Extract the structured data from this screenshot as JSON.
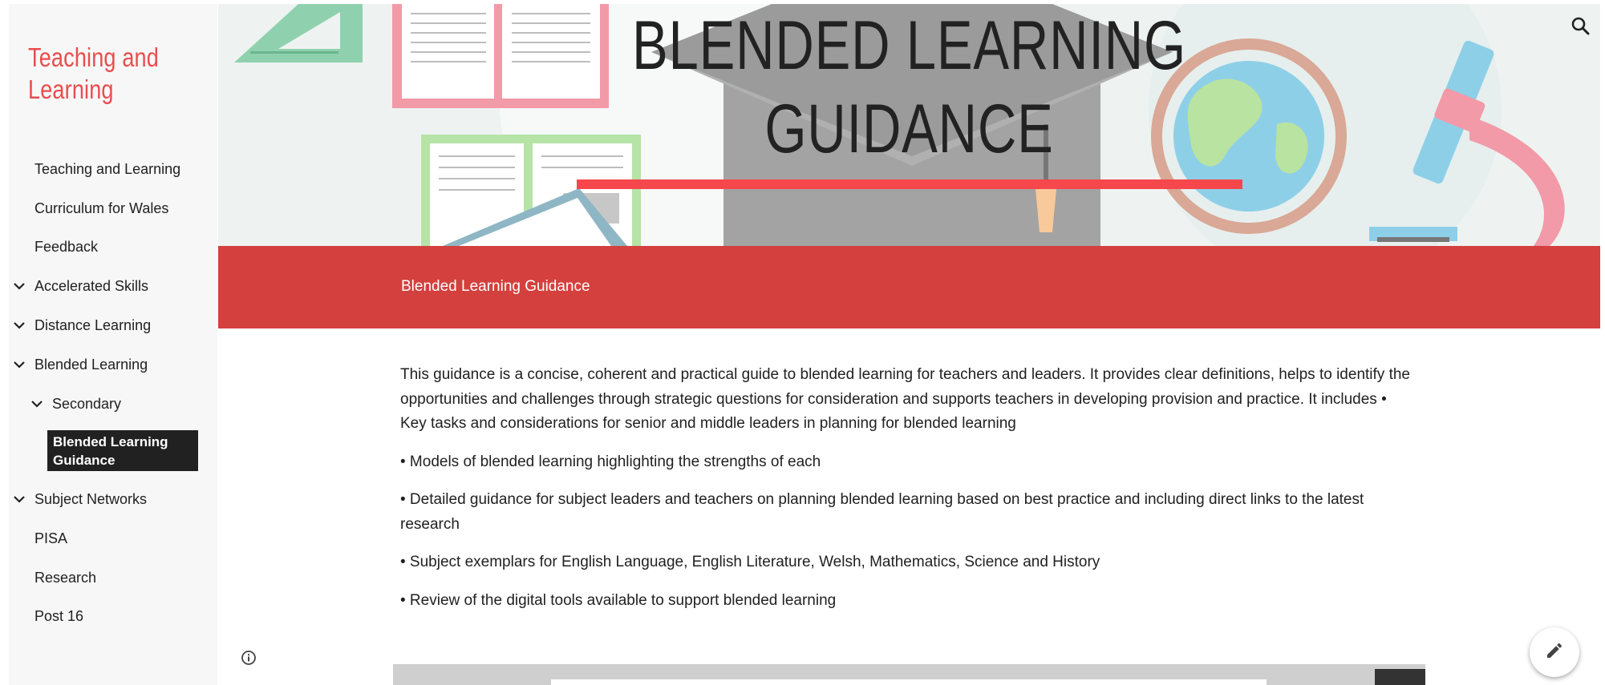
{
  "site": {
    "title": "Teaching and Learning"
  },
  "sidebar": {
    "items": [
      {
        "label": "Teaching and Learning"
      },
      {
        "label": "Curriculum for Wales"
      },
      {
        "label": "Feedback"
      },
      {
        "label": "Accelerated Skills"
      },
      {
        "label": "Distance Learning"
      },
      {
        "label": "Blended Learning"
      },
      {
        "label": "Secondary"
      },
      {
        "label": "Blended Learning Guidance"
      },
      {
        "label": "Subject Networks"
      },
      {
        "label": "PISA"
      },
      {
        "label": "Research"
      },
      {
        "label": "Post 16"
      }
    ]
  },
  "hero": {
    "title_line1": "BLENDED LEARNING",
    "title_line2": "GUIDANCE"
  },
  "band": {
    "title": "Blended Learning Guidance"
  },
  "content": {
    "paragraphs": [
      "This guidance is a concise, coherent and practical guide to blended learning for teachers and leaders. It provides clear definitions, helps to identify the opportunities and challenges through strategic questions for consideration and supports teachers in developing provision and practice. It includes • Key tasks and considerations for senior and middle leaders in planning for blended learning",
      "• Models of blended learning highlighting the strengths of each",
      "• Detailed guidance for subject leaders and teachers on planning blended learning based on best practice and including direct links to the latest research",
      "• Subject exemplars for English Language, English Literature, Welsh, Mathematics, Science and History",
      "• Review of the digital tools available to support blended learning"
    ]
  },
  "colors": {
    "accent": "#e94d4d",
    "band": "#d3403d",
    "hero_line": "#f5474c",
    "active_bg": "#212121"
  },
  "icons": {
    "search": "search-icon",
    "info": "info-icon",
    "edit": "pencil-icon",
    "chevron": "chevron-down-icon"
  }
}
